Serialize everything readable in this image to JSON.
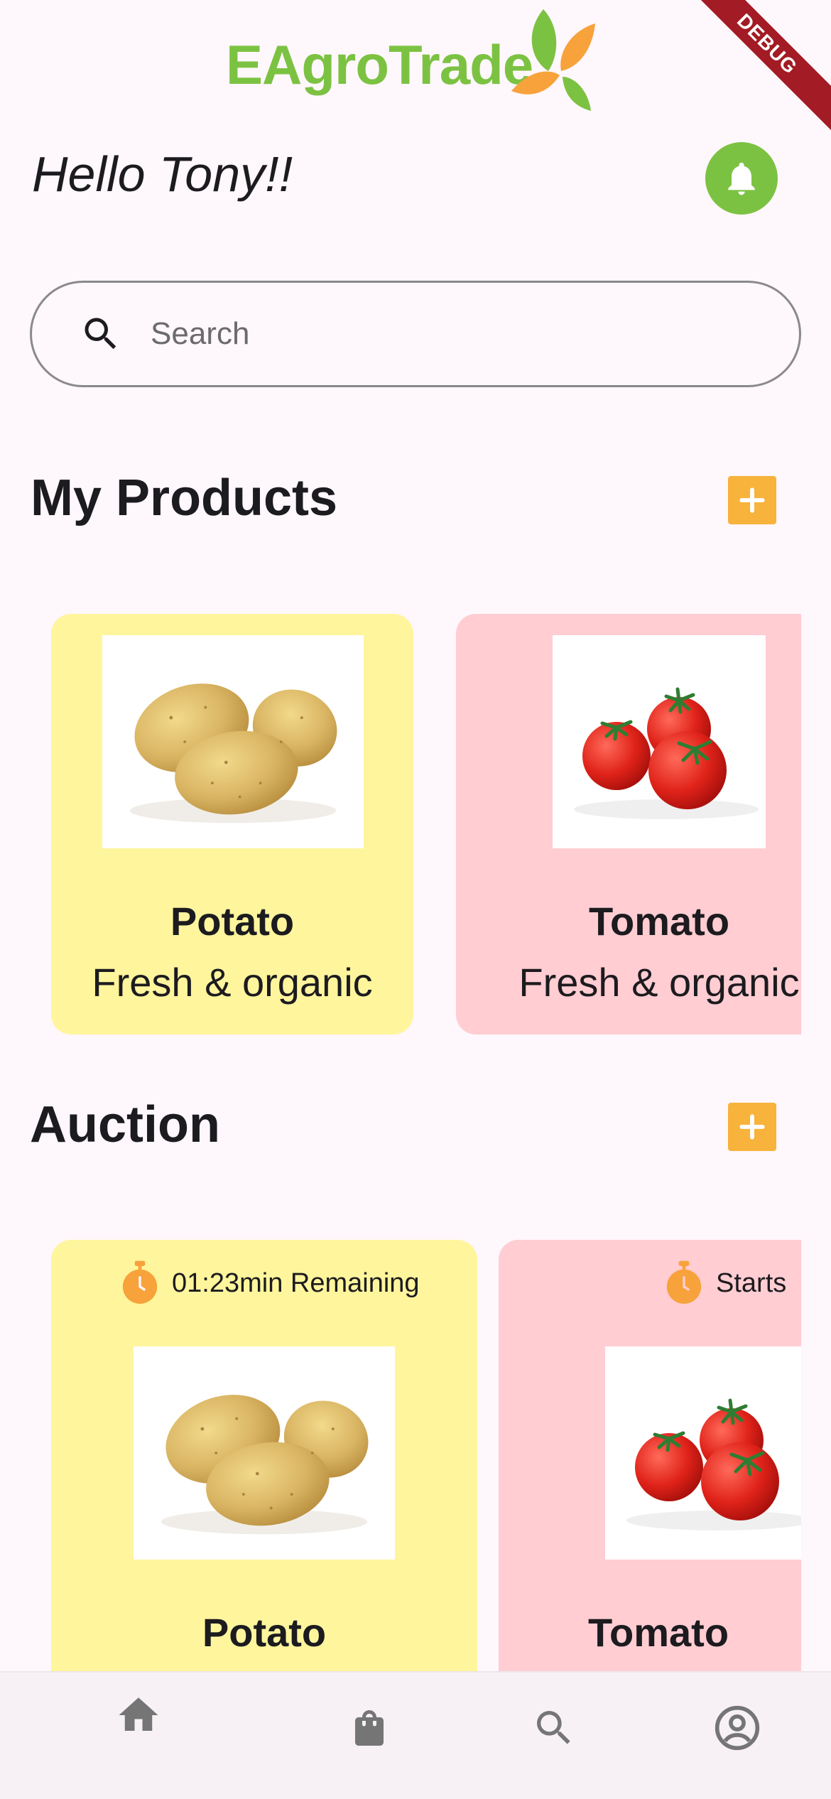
{
  "app": {
    "logo_text": "EAgroTrade",
    "debug_label": "DEBUG",
    "brand_green": "#7cc242",
    "accent_orange": "#f7b33b"
  },
  "header": {
    "greeting": "Hello Tony!!",
    "notification_icon": "bell-icon"
  },
  "search": {
    "placeholder": "Search",
    "value": ""
  },
  "my_products": {
    "title": "My Products",
    "add_icon": "plus-icon",
    "items": [
      {
        "name": "Potato",
        "description": "Fresh & organic",
        "image": "potato",
        "color": "#fff59d"
      },
      {
        "name": "Tomato",
        "description": "Fresh & organic",
        "image": "tomato",
        "color": "#ffcdd2"
      }
    ]
  },
  "auction": {
    "title": "Auction",
    "add_icon": "plus-icon",
    "items": [
      {
        "timer_text": "01:23min Remaining",
        "name": "Potato",
        "image": "potato",
        "color": "#fff59d"
      },
      {
        "timer_text": "Starts",
        "name": "Tomato",
        "image": "tomato",
        "color": "#ffcdd2"
      }
    ]
  },
  "bottom_nav": {
    "items": [
      {
        "icon": "home-icon",
        "active": true
      },
      {
        "icon": "shopping-bag-icon",
        "active": false
      },
      {
        "icon": "search-icon",
        "active": false
      },
      {
        "icon": "account-circle-icon",
        "active": false
      }
    ]
  }
}
